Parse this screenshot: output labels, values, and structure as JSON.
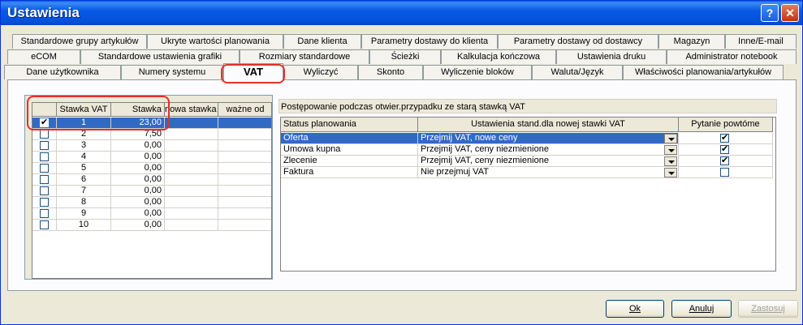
{
  "window": {
    "title": "Ustawienia",
    "help_label": "?",
    "close_label": "✕"
  },
  "tabs": {
    "row1": [
      "Standardowe grupy artykułów",
      "Ukryte wartości planowania",
      "Dane klienta",
      "Parametry dostawy do klienta",
      "Parametry dostawy od dostawcy",
      "Magazyn",
      "Inne/E-mail"
    ],
    "row2": [
      "eCOM",
      "Standardowe ustawienia grafiki",
      "Rozmiary standardowe",
      "Ścieżki",
      "Kalkulacja kończowa",
      "Ustawienia druku",
      "Administrator notebook"
    ],
    "row3": [
      "Dane użytkownika",
      "Numery systemu",
      "VAT",
      "Wyliczyć",
      "Skonto",
      "Wyliczenie bloków",
      "Waluta/Język",
      "Właściwości planowania/artykułów"
    ],
    "active": "VAT"
  },
  "vat_table": {
    "headers": [
      "",
      "Stawka VAT",
      "Stawka",
      "nowa stawka",
      "ważne od"
    ],
    "rows": [
      {
        "checked": true,
        "nr": "1",
        "stawka": "23,00",
        "selected": true
      },
      {
        "checked": false,
        "nr": "2",
        "stawka": "7,50"
      },
      {
        "checked": false,
        "nr": "3",
        "stawka": "0,00"
      },
      {
        "checked": false,
        "nr": "4",
        "stawka": "0,00"
      },
      {
        "checked": false,
        "nr": "5",
        "stawka": "0,00"
      },
      {
        "checked": false,
        "nr": "6",
        "stawka": "0,00"
      },
      {
        "checked": false,
        "nr": "7",
        "stawka": "0,00"
      },
      {
        "checked": false,
        "nr": "8",
        "stawka": "0,00"
      },
      {
        "checked": false,
        "nr": "9",
        "stawka": "0,00"
      },
      {
        "checked": false,
        "nr": "10",
        "stawka": "0,00"
      }
    ]
  },
  "procedure": {
    "title": "Postępowanie podczas otwier.przypadku ze starą stawką VAT",
    "headers": [
      "Status planowania",
      "Ustawienia stand.dla nowej stawki VAT",
      "Pytanie powtóme"
    ],
    "rows": [
      {
        "status": "Oferta",
        "setting": "Przejmij VAT, nowe ceny",
        "ask": true,
        "selected": true
      },
      {
        "status": "Umowa kupna",
        "setting": "Przejmij VAT, ceny niezmienione",
        "ask": true
      },
      {
        "status": "Zlecenie",
        "setting": "Przejmij VAT, ceny niezmienione",
        "ask": true
      },
      {
        "status": "Faktura",
        "setting": "Nie przejmuj VAT",
        "ask": false
      }
    ]
  },
  "buttons": {
    "ok": "Ok",
    "cancel": "Anuluj",
    "apply": "Zastosuj"
  }
}
